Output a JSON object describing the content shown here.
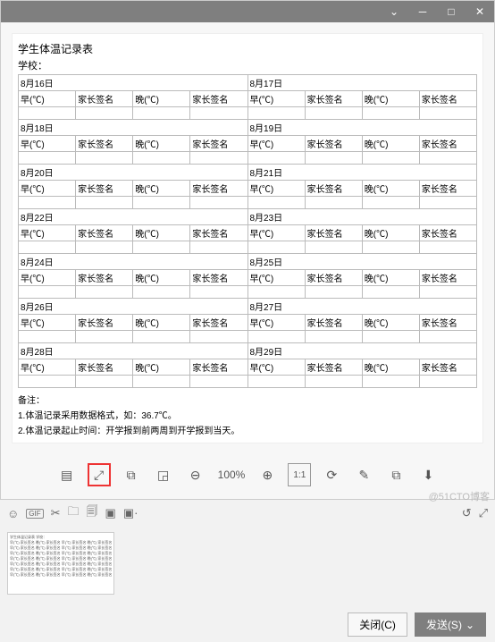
{
  "titlebar": {
    "dropdown": "⌄",
    "min": "─",
    "max": "□",
    "close": "✕"
  },
  "doc": {
    "title": "学生体温记录表",
    "school_label": "学校：",
    "columns": [
      "早(℃)",
      "家长签名",
      "晚(℃)",
      "家长签名"
    ],
    "date_pairs": [
      [
        "8月16日",
        "8月17日"
      ],
      [
        "8月18日",
        "8月19日"
      ],
      [
        "8月20日",
        "8月21日"
      ],
      [
        "8月22日",
        "8月23日"
      ],
      [
        "8月24日",
        "8月25日"
      ],
      [
        "8月26日",
        "8月27日"
      ],
      [
        "8月28日",
        "8月29日"
      ]
    ],
    "notes": {
      "heading": "备注：",
      "lines": [
        "1.体温记录采用数据格式，如：36.7℃。",
        "2.体温记录起止时间：开学报到前两周到开学报到当天。"
      ]
    }
  },
  "toolbar": {
    "grid": "▤",
    "expand": "⤢",
    "copy": "⧉",
    "crop": "◲",
    "zoom_out": "⊖",
    "zoom_pct": "100%",
    "zoom_in": "⊕",
    "fit": "1:1",
    "rotate": "⟳",
    "edit": "✎",
    "crop2": "⧉",
    "download": "⬇"
  },
  "chat_tools": {
    "emoji": "☺",
    "gif": "GIF",
    "cut": "✂",
    "folder": "🗀",
    "history": "🗐",
    "image": "▣",
    "capture": "▣·"
  },
  "chat_tools_right": {
    "phone": "↺",
    "expand": "⤢"
  },
  "chat_footer": {
    "close": "关闭(C)",
    "send": "发送(S)",
    "arrow": "⌄"
  },
  "watermark": "@51CTO博客",
  "thumb": {
    "title": "学生体温记录表  学校：",
    "row": "早(℃) 家长签名 晚(℃) 家长签名 早(℃) 家长签名 晚(℃) 家长签名"
  }
}
